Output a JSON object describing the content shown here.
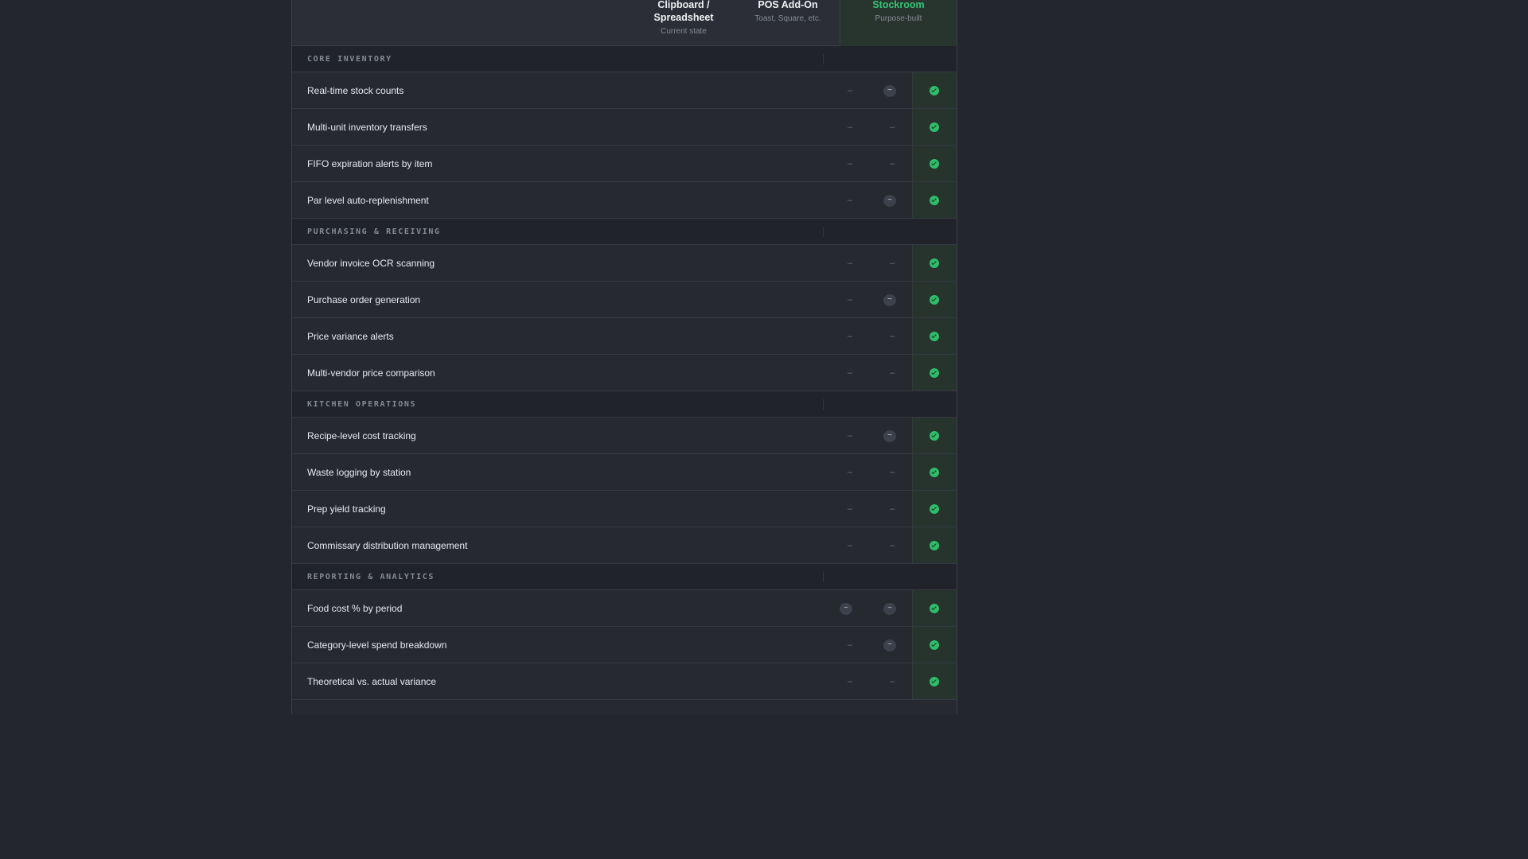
{
  "header": {
    "columns": [
      {
        "name": "Clipboard / Spreadsheet",
        "sub": "Current state"
      },
      {
        "name": "POS Add-On",
        "sub": "Toast, Square, etc."
      },
      {
        "name": "Stockroom",
        "sub": "Purpose-built"
      }
    ]
  },
  "symbols": {
    "none": "–",
    "partial": "~"
  },
  "sections": [
    {
      "title": "CORE INVENTORY",
      "rows": [
        {
          "label": "Real-time stock counts",
          "clipboard": "none",
          "pos": "partial",
          "stockroom": "full"
        },
        {
          "label": "Multi-unit inventory transfers",
          "clipboard": "none",
          "pos": "none",
          "stockroom": "full"
        },
        {
          "label": "FIFO expiration alerts by item",
          "clipboard": "none",
          "pos": "none",
          "stockroom": "full"
        },
        {
          "label": "Par level auto-replenishment",
          "clipboard": "none",
          "pos": "partial",
          "stockroom": "full"
        }
      ]
    },
    {
      "title": "PURCHASING & RECEIVING",
      "rows": [
        {
          "label": "Vendor invoice OCR scanning",
          "clipboard": "none",
          "pos": "none",
          "stockroom": "full"
        },
        {
          "label": "Purchase order generation",
          "clipboard": "none",
          "pos": "partial",
          "stockroom": "full"
        },
        {
          "label": "Price variance alerts",
          "clipboard": "none",
          "pos": "none",
          "stockroom": "full"
        },
        {
          "label": "Multi-vendor price comparison",
          "clipboard": "none",
          "pos": "none",
          "stockroom": "full"
        }
      ]
    },
    {
      "title": "KITCHEN OPERATIONS",
      "rows": [
        {
          "label": "Recipe-level cost tracking",
          "clipboard": "none",
          "pos": "partial",
          "stockroom": "full"
        },
        {
          "label": "Waste logging by station",
          "clipboard": "none",
          "pos": "none",
          "stockroom": "full"
        },
        {
          "label": "Prep yield tracking",
          "clipboard": "none",
          "pos": "none",
          "stockroom": "full"
        },
        {
          "label": "Commissary distribution management",
          "clipboard": "none",
          "pos": "none",
          "stockroom": "full"
        }
      ]
    },
    {
      "title": "REPORTING & ANALYTICS",
      "rows": [
        {
          "label": "Food cost % by period",
          "clipboard": "partial",
          "pos": "partial",
          "stockroom": "full"
        },
        {
          "label": "Category-level spend breakdown",
          "clipboard": "none",
          "pos": "partial",
          "stockroom": "full"
        },
        {
          "label": "Theoretical vs. actual variance",
          "clipboard": "none",
          "pos": "none",
          "stockroom": "full"
        }
      ]
    }
  ]
}
